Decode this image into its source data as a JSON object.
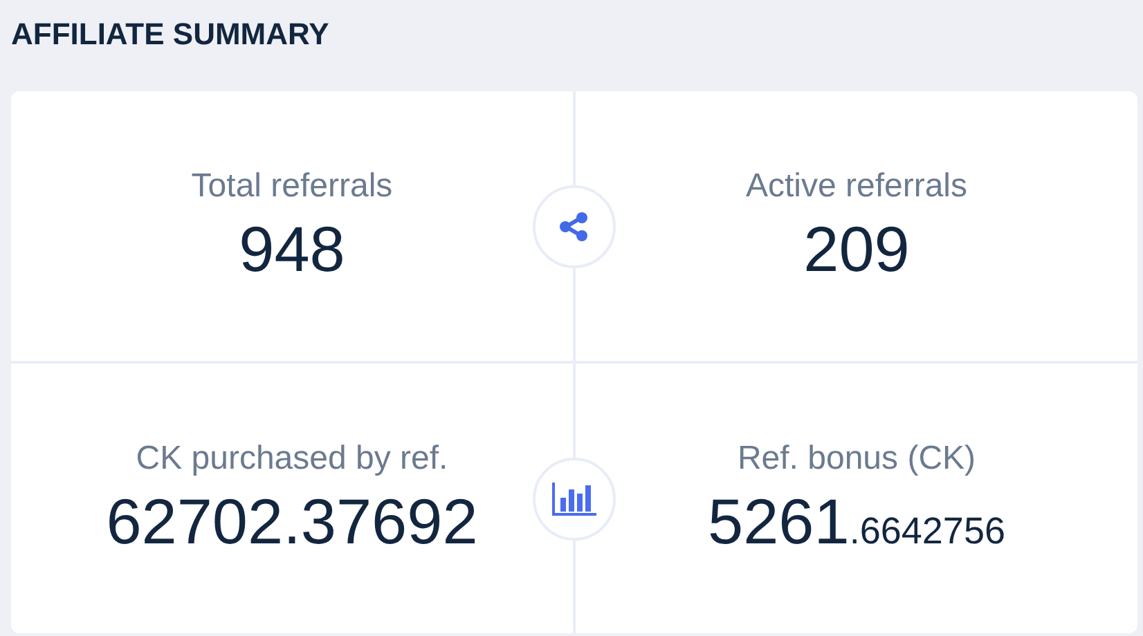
{
  "title": "AFFILIATE SUMMARY",
  "rows": [
    {
      "stats": [
        {
          "label": "Total referrals",
          "value": "948"
        },
        {
          "label": "Active referrals",
          "value": "209"
        }
      ]
    },
    {
      "stats": [
        {
          "label": "CK purchased by ref.",
          "value": "62702.37692"
        },
        {
          "label": "Ref. bonus (CK)",
          "value": "5261",
          "fraction": ".6642756"
        }
      ]
    }
  ]
}
